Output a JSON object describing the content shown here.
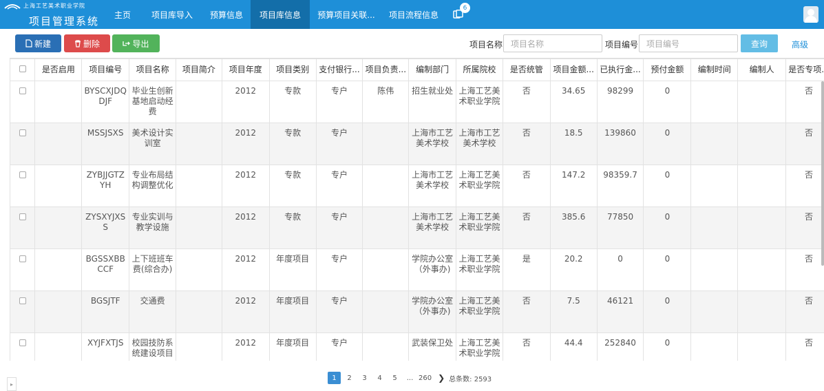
{
  "header": {
    "school_script": "上海工艺美术职业学院",
    "app_title": "项目管理系统",
    "nav": [
      {
        "label": "主页",
        "width": 56
      },
      {
        "label": "项目库导入",
        "width": 88
      },
      {
        "label": "预算信息",
        "width": 70
      },
      {
        "label": "项目库信息",
        "width": 86
      },
      {
        "label": "预算项目关联...",
        "width": 106
      },
      {
        "label": "项目流程信息",
        "width": 90
      }
    ],
    "active_nav": 3,
    "notification_count": "6"
  },
  "toolbar": {
    "new_label": "新建",
    "delete_label": "删除",
    "export_label": "导出",
    "name_label": "项目名称:",
    "name_placeholder": "项目名称",
    "code_label": "项目编号:",
    "code_placeholder": "项目编号",
    "query_label": "查询",
    "advanced_label": "高级"
  },
  "table": {
    "columns": [
      "是否启用",
      "项目编号",
      "项目名称",
      "项目简介",
      "项目年度",
      "项目类别",
      "支付银行...",
      "项目负责...",
      "编制部门",
      "所属院校",
      "是否统管",
      "项目金额...",
      "已执行金...",
      "预付金额",
      "编制时间",
      "编制人",
      "是否专项..."
    ],
    "rows": [
      [
        "",
        "BYSCXJDQDJF",
        "毕业生创新基地启动经费",
        "",
        "2012",
        "专款",
        "专户",
        "陈伟",
        "招生就业处",
        "上海工艺美术职业学院",
        "否",
        "34.65",
        "98299",
        "0",
        "",
        "",
        "否"
      ],
      [
        "",
        "MSSJSXS",
        "美术设计实训室",
        "",
        "2012",
        "专款",
        "专户",
        "",
        "上海市工艺美术学校",
        "上海市工艺美术学校",
        "否",
        "18.5",
        "139860",
        "0",
        "",
        "",
        "否"
      ],
      [
        "",
        "ZYBJJGTZYH",
        "专业布局结构调整优化",
        "",
        "2012",
        "专款",
        "专户",
        "",
        "上海市工艺美术学校",
        "上海工艺美术职业学院",
        "否",
        "147.2",
        "98359.7",
        "0",
        "",
        "",
        "否"
      ],
      [
        "",
        "ZYSXYJXSS",
        "专业实训与教学设施",
        "",
        "2012",
        "专款",
        "专户",
        "",
        "上海市工艺美术学校",
        "上海工艺美术职业学院",
        "否",
        "385.6",
        "77850",
        "0",
        "",
        "",
        "否"
      ],
      [
        "",
        "BGSSXBBCCF",
        "上下班班车费(综合办)",
        "",
        "2012",
        "年度项目",
        "专户",
        "",
        "学院办公室（外事办)",
        "上海工艺美术职业学院",
        "是",
        "20.2",
        "0",
        "0",
        "",
        "",
        "否"
      ],
      [
        "",
        "BGSJTF",
        "交通费",
        "",
        "2012",
        "年度项目",
        "专户",
        "",
        "学院办公室（外事办)",
        "上海工艺美术职业学院",
        "否",
        "7.5",
        "46121",
        "0",
        "",
        "",
        "否"
      ],
      [
        "",
        "XYJFXTJS",
        "校园技防系统建设项目",
        "",
        "2012",
        "年度项目",
        "专户",
        "",
        "武装保卫处",
        "上海工艺美术职业学院",
        "否",
        "44.4",
        "252840",
        "0",
        "",
        "",
        "否"
      ]
    ]
  },
  "pager": {
    "pages": [
      "1",
      "2",
      "3",
      "4",
      "5",
      "...",
      "260"
    ],
    "current": "1",
    "next_symbol": "❯",
    "total_label": "总条数: 2593"
  }
}
